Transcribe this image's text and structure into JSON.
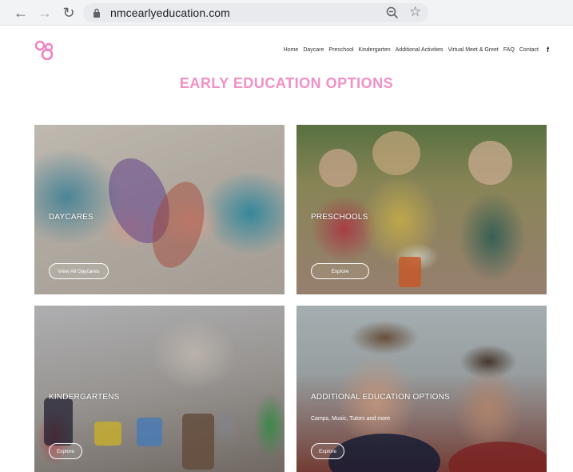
{
  "browser": {
    "url": "nmcearlyeducation.com"
  },
  "nav": {
    "items": [
      "Home",
      "Daycare",
      "Preschool",
      "Kindergarten",
      "Additional Activities",
      "Virtual Meet & Greet",
      "FAQ",
      "Contact"
    ],
    "social_icon": "facebook-icon"
  },
  "page": {
    "title": "EARLY EDUCATION OPTIONS",
    "accent_color": "#f28fc6"
  },
  "cards": [
    {
      "title": "DAYCARES",
      "subtitle": "",
      "button": "View All Daycares"
    },
    {
      "title": "PRESCHOOLS",
      "subtitle": "",
      "button": "Explore"
    },
    {
      "title": "KINDERGARTENS",
      "subtitle": "",
      "button": "Explore"
    },
    {
      "title": "ADDITIONAL EDUCATION OPTIONS",
      "subtitle": "Camps, Music, Tutors and more",
      "button": "Explore"
    }
  ]
}
